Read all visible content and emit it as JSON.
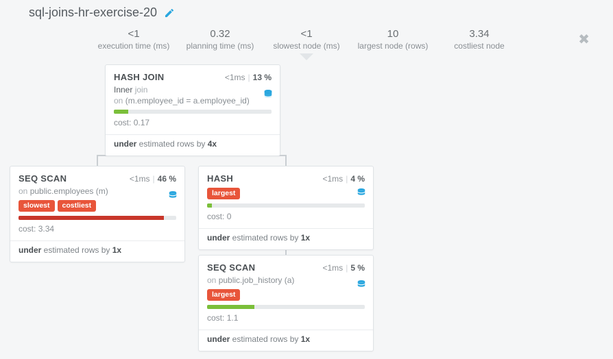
{
  "title": "sql-joins-hr-exercise-20",
  "stats": {
    "exec_time": {
      "value": "<1",
      "label": "execution time (ms)"
    },
    "plan_time": {
      "value": "0.32",
      "label": "planning time (ms)"
    },
    "slowest": {
      "value": "<1",
      "label": "slowest node (ms)"
    },
    "largest": {
      "value": "10",
      "label": "largest node (rows)"
    },
    "costliest": {
      "value": "3.34",
      "label": "costliest node"
    }
  },
  "nodes": {
    "hashjoin": {
      "name": "HASH JOIN",
      "time": "<1ms",
      "pct": "13 %",
      "line1_strong": "Inner",
      "line1_dim": "join",
      "line2_dim": "on",
      "line2_rest": "(m.employee_id = a.employee_id)",
      "bar_width": "9%",
      "bar_class": "bar-green",
      "cost_label": "cost:",
      "cost_value": "0.17",
      "est_prefix": "under",
      "est_mid": " estimated rows by ",
      "est_factor": "4x"
    },
    "seqscan1": {
      "name": "SEQ SCAN",
      "time": "<1ms",
      "pct": "46 %",
      "on_dim": "on",
      "on_rest": "public.employees (m)",
      "badges": [
        "slowest",
        "costliest"
      ],
      "bar_width": "92%",
      "bar_class": "bar-red",
      "cost_label": "cost:",
      "cost_value": "3.34",
      "est_prefix": "under",
      "est_mid": " estimated rows by ",
      "est_factor": "1x"
    },
    "hash": {
      "name": "HASH",
      "time": "<1ms",
      "pct": "4 %",
      "badges": [
        "largest"
      ],
      "bar_width": "3%",
      "bar_class": "bar-green",
      "cost_label": "cost:",
      "cost_value": "0",
      "est_prefix": "under",
      "est_mid": " estimated rows by ",
      "est_factor": "1x"
    },
    "seqscan2": {
      "name": "SEQ SCAN",
      "time": "<1ms",
      "pct": "5 %",
      "on_dim": "on",
      "on_rest": "public.job_history (a)",
      "badges": [
        "largest"
      ],
      "bar_width": "30%",
      "bar_class": "bar-green",
      "cost_label": "cost:",
      "cost_value": "1.1",
      "est_prefix": "under",
      "est_mid": " estimated rows by ",
      "est_factor": "1x"
    }
  }
}
